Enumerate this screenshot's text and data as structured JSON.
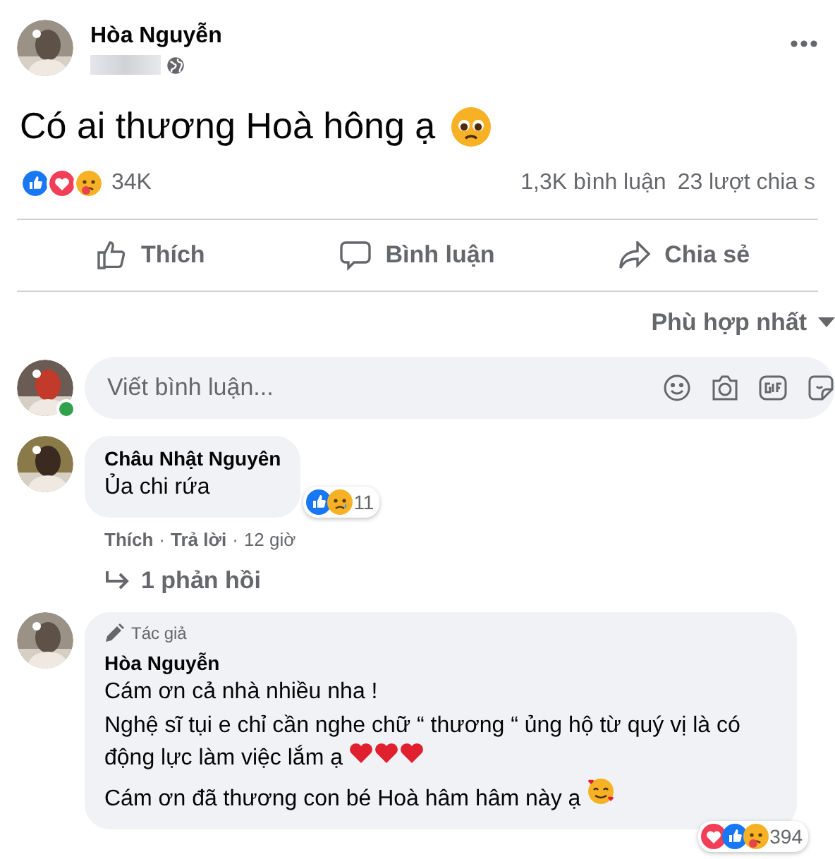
{
  "post": {
    "author": "Hòa Nguyễn",
    "text": "Có ai thương Hoà hông ạ",
    "reaction_count": "34K",
    "comments_count": "1,3K bình luận",
    "shares_count": "23 lượt chia s"
  },
  "actions": [
    {
      "kind": "like",
      "label": "Thích"
    },
    {
      "kind": "comment",
      "label": "Bình luận"
    },
    {
      "kind": "share",
      "label": "Chia sẻ"
    }
  ],
  "sort": {
    "label": "Phù hợp nhất"
  },
  "comment_box": {
    "placeholder": "Viết bình luận..."
  },
  "comments": [
    {
      "author": "Châu Nhật Nguyên",
      "lines": [
        "Ủa chi rứa"
      ],
      "reaction_count": "11",
      "actions": [
        "Thích",
        "Trả lời"
      ],
      "separator": "·",
      "time": "12 giờ",
      "replies": "1 phản hồi"
    },
    {
      "badge": "Tác giả",
      "author": "Hòa Nguyễn",
      "lines": [
        "Cám ơn cả nhà nhiều nha !",
        "Nghệ sĩ tụi e chỉ cần nghe chữ “ thương “ ủng hộ từ quý vị là có động lực làm việc lắm ạ",
        "Cám ơn đã thương con bé Hoà hâm hâm này ạ"
      ],
      "reaction_count": "394"
    }
  ]
}
